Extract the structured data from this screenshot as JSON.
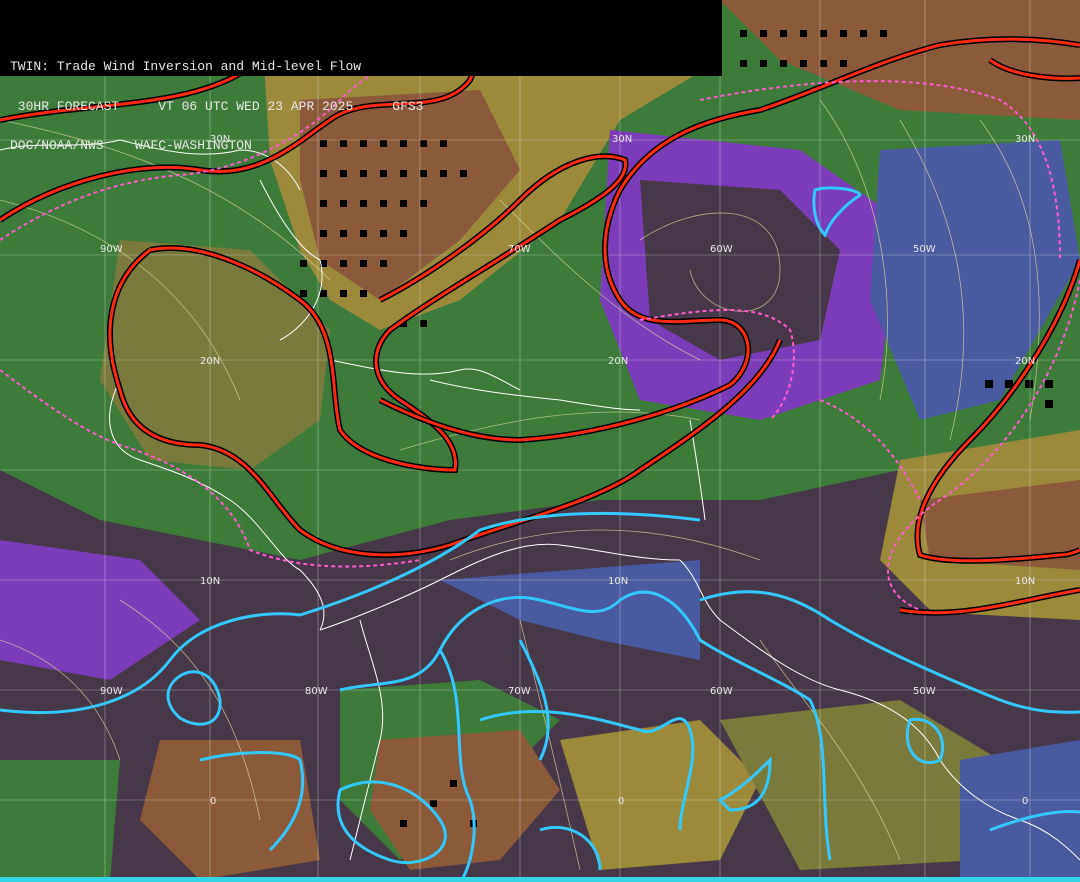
{
  "header": {
    "line1": "TWIN: Trade Wind Inversion and Mid-level Flow",
    "line2": " 30HR FORECAST     VT 06 UTC WED 23 APR 2025     GFS3",
    "line3": "DOC/NOAA/NWS    WAFC-WASHINGTON"
  },
  "grid_labels": {
    "lat": [
      "30N",
      "30N",
      "20N",
      "20N",
      "20N",
      "10N",
      "10N",
      "10N",
      "0",
      "0",
      "0",
      "30N"
    ],
    "lon": [
      "90W",
      "70W",
      "60W",
      "50W",
      "90W",
      "80W",
      "70W",
      "60W",
      "50W",
      "80W"
    ]
  },
  "colors": {
    "background_dark": "#463848",
    "purple": "#7a3cb8",
    "blue": "#4a5aa0",
    "green": "#3e7a3a",
    "olive": "#9a8a3a",
    "brown": "#8a5a3a",
    "inversion_contour": "#ff2a10",
    "inversion_dashed": "#ff5ad0",
    "cyan_contour": "#33c8ff",
    "coast": "#ffffff",
    "streamline": "#e8e0a0"
  }
}
